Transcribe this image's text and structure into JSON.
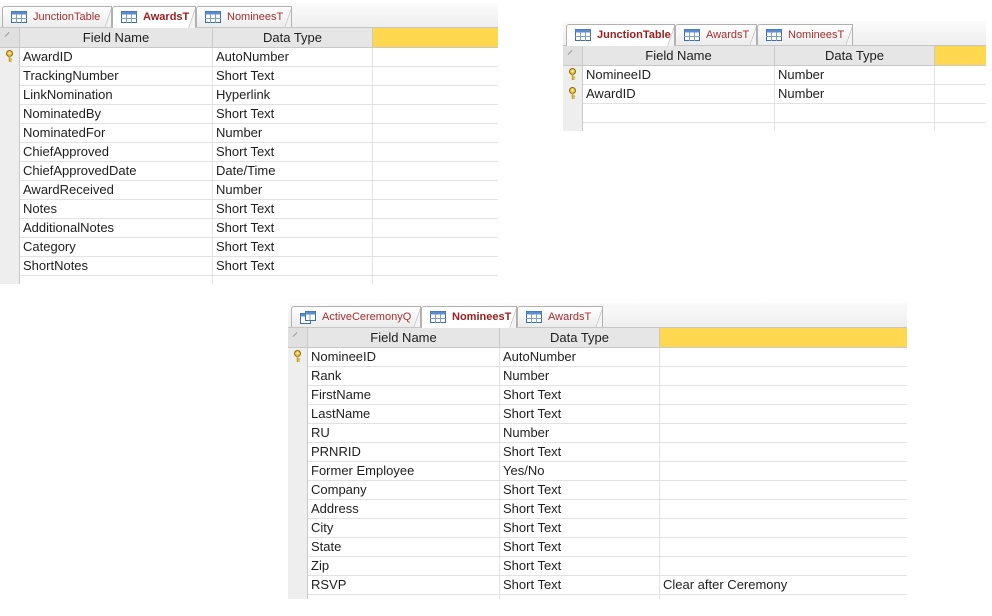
{
  "colors": {
    "accent_tab_text": "#9b2020",
    "header_bg": "#e6e6e6",
    "description_header": "#ffd84f"
  },
  "icons": {
    "table": "table-icon",
    "query": "query-icon",
    "primary_key": "key-icon"
  },
  "awards_design": {
    "tabs": [
      "JunctionTable",
      "AwardsT",
      "NomineesT"
    ],
    "active_tab": "AwardsT",
    "headers": {
      "field_name": "Field Name",
      "data_type": "Data Type"
    },
    "rows": [
      {
        "field": "AwardID",
        "type": "AutoNumber",
        "description": ""
      },
      {
        "field": "TrackingNumber",
        "type": "Short Text",
        "description": ""
      },
      {
        "field": "LinkNomination",
        "type": "Hyperlink",
        "description": ""
      },
      {
        "field": "NominatedBy",
        "type": "Short Text",
        "description": ""
      },
      {
        "field": "NominatedFor",
        "type": "Number",
        "description": ""
      },
      {
        "field": "ChiefApproved",
        "type": "Short Text",
        "description": ""
      },
      {
        "field": "ChiefApprovedDate",
        "type": "Date/Time",
        "description": ""
      },
      {
        "field": "AwardReceived",
        "type": "Number",
        "description": ""
      },
      {
        "field": "Notes",
        "type": "Short Text",
        "description": ""
      },
      {
        "field": "AdditionalNotes",
        "type": "Short Text",
        "description": ""
      },
      {
        "field": "Category",
        "type": "Short Text",
        "description": ""
      },
      {
        "field": "ShortNotes",
        "type": "Short Text",
        "description": ""
      }
    ]
  },
  "junction_design": {
    "tabs": [
      "JunctionTable",
      "AwardsT",
      "NomineesT"
    ],
    "active_tab": "JunctionTable",
    "headers": {
      "field_name": "Field Name",
      "data_type": "Data Type"
    },
    "rows": [
      {
        "field": "NomineeID",
        "type": "Number",
        "description": ""
      },
      {
        "field": "AwardID",
        "type": "Number",
        "description": ""
      }
    ]
  },
  "nominees_design": {
    "tabs": [
      "ActiveCeremonyQ",
      "NomineesT",
      "AwardsT"
    ],
    "active_tab": "NomineesT",
    "headers": {
      "field_name": "Field Name",
      "data_type": "Data Type"
    },
    "rows": [
      {
        "field": "NomineeID",
        "type": "AutoNumber",
        "description": ""
      },
      {
        "field": "Rank",
        "type": "Number",
        "description": ""
      },
      {
        "field": "FirstName",
        "type": "Short Text",
        "description": ""
      },
      {
        "field": "LastName",
        "type": "Short Text",
        "description": ""
      },
      {
        "field": "RU",
        "type": "Number",
        "description": ""
      },
      {
        "field": "PRNRID",
        "type": "Short Text",
        "description": ""
      },
      {
        "field": "Former Employee",
        "type": "Yes/No",
        "description": ""
      },
      {
        "field": "Company",
        "type": "Short Text",
        "description": ""
      },
      {
        "field": "Address",
        "type": "Short Text",
        "description": ""
      },
      {
        "field": "City",
        "type": "Short Text",
        "description": ""
      },
      {
        "field": "State",
        "type": "Short Text",
        "description": ""
      },
      {
        "field": "Zip",
        "type": "Short Text",
        "description": ""
      },
      {
        "field": "RSVP",
        "type": "Short Text",
        "description": "Clear after Ceremony"
      }
    ]
  }
}
